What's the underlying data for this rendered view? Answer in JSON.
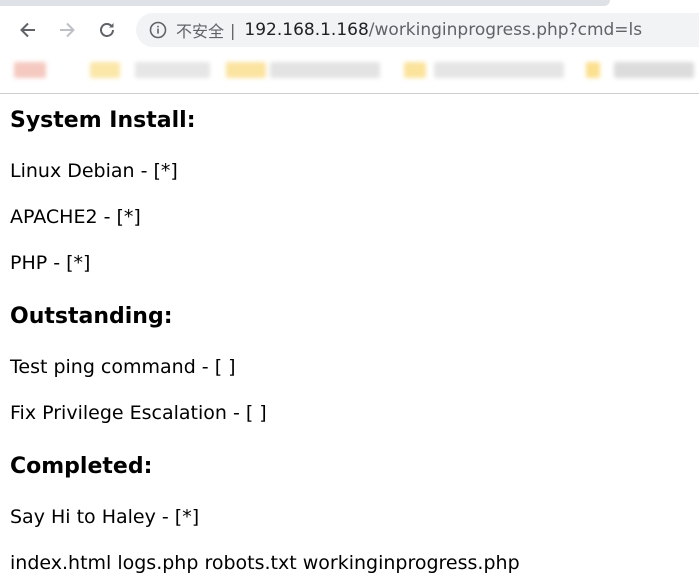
{
  "browser": {
    "security_label": "不安全",
    "separator": "|",
    "url_host": "192.168.1.168",
    "url_path": "/workinginprogress.php?cmd=ls",
    "icons": {
      "back": "back-arrow-icon",
      "forward": "forward-arrow-icon",
      "reload": "reload-icon",
      "info": "info-icon"
    }
  },
  "page": {
    "system_install": {
      "heading": "System Install:",
      "items": [
        "Linux Debian - [*]",
        "APACHE2 - [*]",
        "PHP - [*]"
      ]
    },
    "outstanding": {
      "heading": "Outstanding:",
      "items": [
        "Test ping command - [ ]",
        "Fix Privilege Escalation - [ ]"
      ]
    },
    "completed": {
      "heading": "Completed:",
      "items": [
        "Say Hi to Haley - [*]"
      ]
    },
    "command_output": "index.html logs.php robots.txt workinginprogress.php"
  }
}
